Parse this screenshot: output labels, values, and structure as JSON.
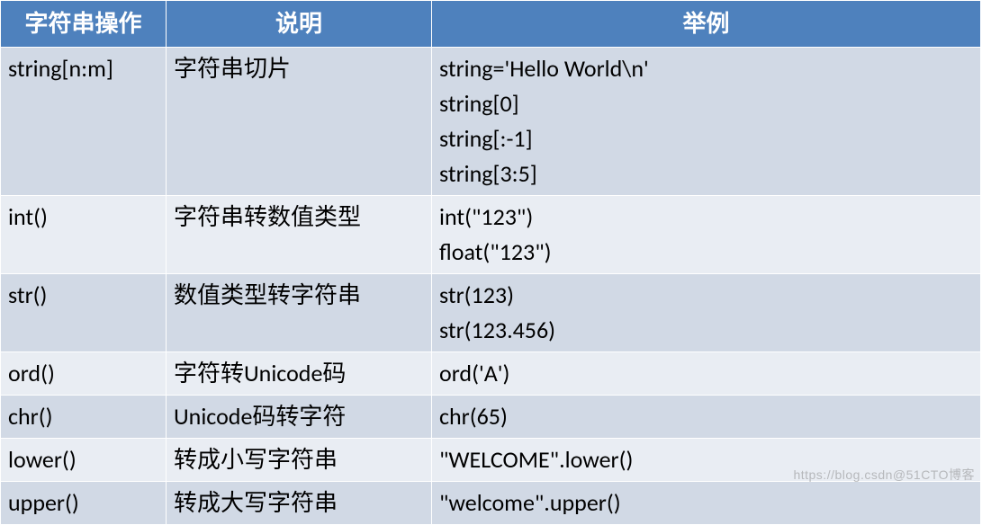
{
  "chart_data": {
    "type": "table",
    "headers": [
      "字符串操作",
      "说明",
      "举例"
    ],
    "rows": [
      {
        "op": "string[n:m]",
        "desc": "字符串切片",
        "examples": [
          "string='Hello World\\n'",
          "string[0]",
          "string[:-1]",
          "string[3:5]"
        ]
      },
      {
        "op": "int()",
        "desc": "字符串转数值类型",
        "examples": [
          "int(\"123\")",
          "float(\"123\")"
        ]
      },
      {
        "op": "str()",
        "desc": "数值类型转字符串",
        "examples": [
          "str(123)",
          "str(123.456)"
        ]
      },
      {
        "op": "ord()",
        "desc": "字符转Unicode码",
        "examples": [
          "ord('A')"
        ]
      },
      {
        "op": "chr()",
        "desc": "Unicode码转字符",
        "examples": [
          "chr(65)"
        ]
      },
      {
        "op": "lower()",
        "desc": "转成小写字符串",
        "examples": [
          "\"WELCOME\".lower()"
        ]
      },
      {
        "op": "upper()",
        "desc": "转成大写字符串",
        "examples": [
          "\"welcome\".upper()"
        ]
      }
    ]
  },
  "watermark": "https://blog.csdn@51CTO博客"
}
